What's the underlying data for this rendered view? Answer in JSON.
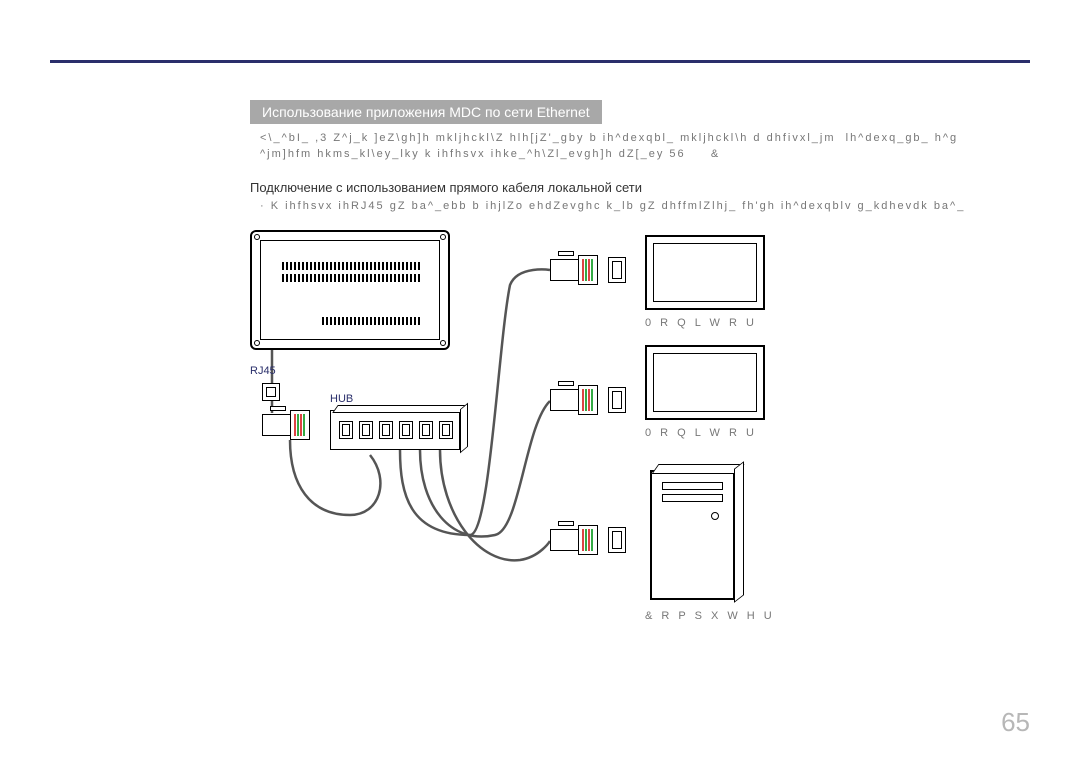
{
  "section_title": "Использование приложения MDC по сети Ethernet",
  "body_line1": "<\\_^bI_ ,3 Z^j_k ]eZ\\gh]h mkljhckl\\Z hlh[jZ'_gby b ih^dexqbl_ mkljhckl\\h d dhfivxl_jm  lh^dexq_gb_ h^g",
  "body_line2": "^jm]hfm hkms_kl\\ey_lky k ihfhsvx ihke_^h\\Zl_evgh]h dZ[_ey 56     &",
  "subheading": "Подключение с использованием прямого кабеля локальной сети",
  "note_text": "· K ihfhsvx ihRJ45 gZ ba^_ebb b ihjlZo ehdZevghc k_lb gZ dhffmlZlhj_ fh'gh ih^dexqblv g_kdhevdk ba^_",
  "labels": {
    "rj45": "RJ45",
    "hub": "HUB",
    "monitor": "0 R Q L W R U",
    "computer": "& R P S X W H U"
  },
  "page_number": "65"
}
